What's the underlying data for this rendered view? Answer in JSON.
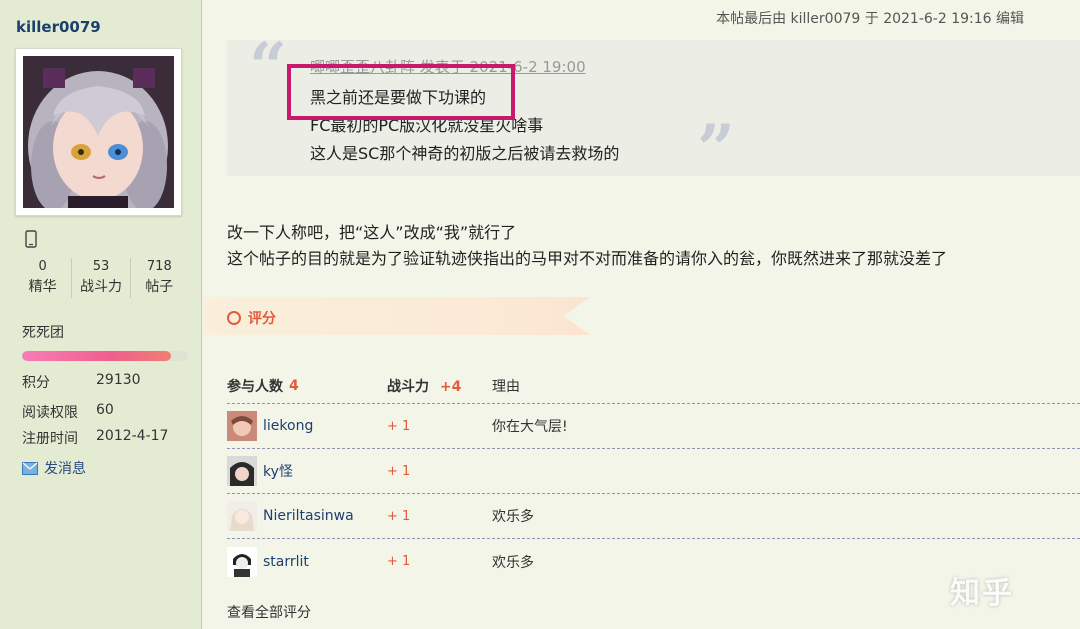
{
  "sidebar": {
    "username": "killer0079",
    "stats": [
      {
        "value": "0",
        "label": "精华"
      },
      {
        "value": "53",
        "label": "战斗力"
      },
      {
        "value": "718",
        "label": "帖子"
      }
    ],
    "group": "死死团",
    "group_progress": 0.9,
    "info": [
      {
        "key": "积分",
        "value": "29130"
      },
      {
        "key": "阅读权限",
        "value": "60"
      },
      {
        "key": "注册时间",
        "value": "2012-4-17"
      }
    ],
    "send_message": "发消息"
  },
  "post": {
    "last_edit": "本帖最后由 killer0079 于 2021-6-2 19:16 编辑",
    "quote": {
      "header": "唧唧歪歪八卦阵 发表于 2021-6-2 19:00",
      "lines": [
        "黑之前还是要做下功课的",
        "FC最初的PC版汉化就没星火啥事",
        "这人是SC那个神奇的初版之后被请去救场的"
      ]
    },
    "body": [
      "改一下人称吧，把“这人”改成“我”就行了",
      "这个帖子的目的就是为了验证轨迹侠指出的马甲对不对而准备的请你入的瓮，你既然进来了那就没差了"
    ]
  },
  "rating": {
    "title": "评分",
    "headers": {
      "participants": "参与人数",
      "participant_count": "4",
      "power": "战斗力",
      "power_total": "+4",
      "reason": "理由"
    },
    "rows": [
      {
        "user": "liekong",
        "score": "+ 1",
        "reason": "你在大气层!"
      },
      {
        "user": "ky怪",
        "score": "+ 1",
        "reason": ""
      },
      {
        "user": "Nieriltasinwa",
        "score": "+ 1",
        "reason": "欢乐多"
      },
      {
        "user": "starrlit",
        "score": "+ 1",
        "reason": "欢乐多"
      }
    ],
    "view_all": "查看全部评分"
  },
  "watermark": "知乎"
}
